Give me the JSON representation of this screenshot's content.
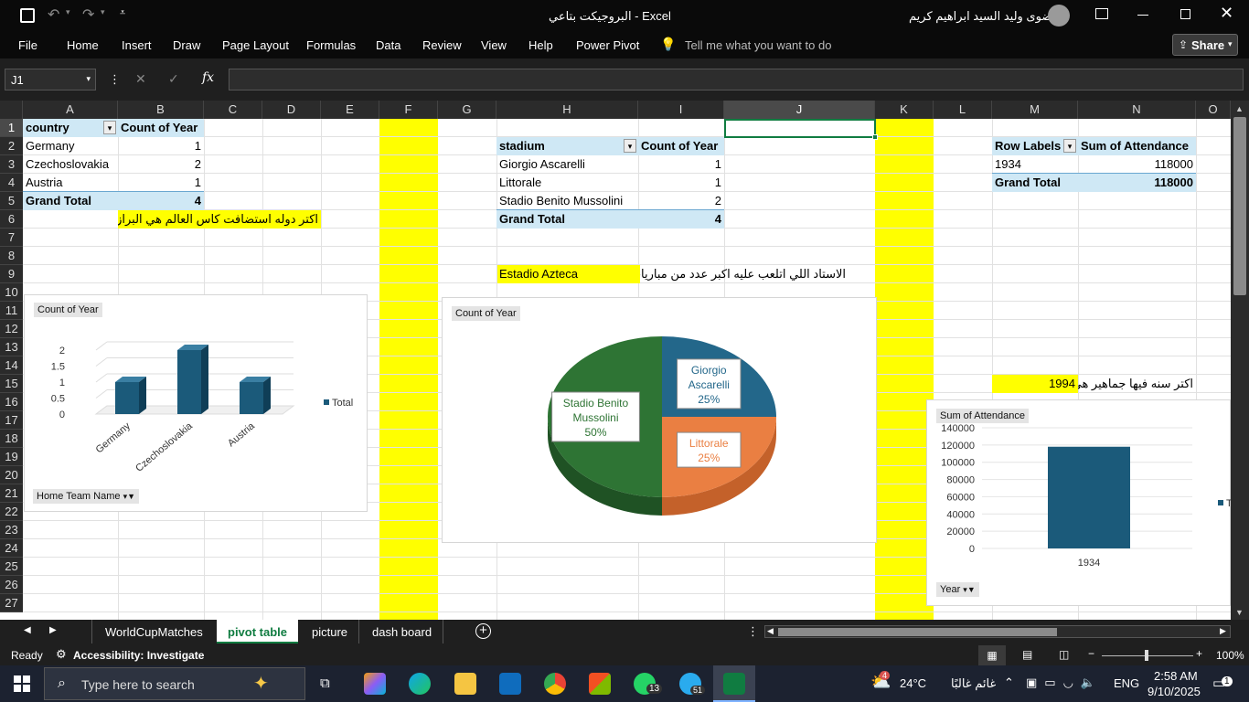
{
  "title": {
    "doc_name": "البروجيكت بتاعي",
    "app_sep": " - ",
    "app": "Excel",
    "user": "رضوى وليد السيد ابراهيم كريم"
  },
  "menu": [
    "File",
    "Home",
    "Insert",
    "Draw",
    "Page Layout",
    "Formulas",
    "Data",
    "Review",
    "View",
    "Help",
    "Power Pivot"
  ],
  "tell_me": "Tell me what you want to do",
  "share": "Share",
  "namebox": "J1",
  "columns": [
    "A",
    "B",
    "C",
    "D",
    "E",
    "F",
    "G",
    "H",
    "I",
    "J",
    "K",
    "L",
    "M",
    "N",
    "O"
  ],
  "rows": [
    "1",
    "2",
    "3",
    "4",
    "5",
    "6",
    "7",
    "8",
    "9",
    "10",
    "11",
    "12",
    "13",
    "14",
    "15",
    "16",
    "17",
    "18",
    "19",
    "20",
    "21",
    "22",
    "23",
    "24",
    "25",
    "26",
    "27"
  ],
  "pivot1": {
    "h1": "country",
    "h2": "Count of Year",
    "rows": [
      [
        "Germany",
        "1"
      ],
      [
        "Czechoslovakia",
        "2"
      ],
      [
        "Austria",
        "1"
      ]
    ],
    "total_label": "Grand Total",
    "total": "4"
  },
  "note1": "اكتر دوله استضافت كاس العالم هي البرازيل",
  "pivot2": {
    "h1": "stadium",
    "h2": "Count of Year",
    "rows": [
      [
        "Giorgio Ascarelli",
        "1"
      ],
      [
        "Littorale",
        "1"
      ],
      [
        "Stadio Benito Mussolini",
        "2"
      ]
    ],
    "total_label": "Grand Total",
    "total": "4"
  },
  "note2_highlight": "Estadio Azteca",
  "note2_rest": "الاستاد اللي اتلعب عليه اكبر عدد من مباريات كاس العالم هو",
  "pivot3": {
    "h1": "Row Labels",
    "h2": "Sum of Attendance",
    "row": [
      "1934",
      "118000"
    ],
    "total_label": "Grand Total",
    "total": "118000"
  },
  "note3_text": "اكتر سنه فيها جماهير هي",
  "note3_year": "1994",
  "chart_data": [
    {
      "type": "bar",
      "title": "Count of Year",
      "categories": [
        "Germany",
        "Czechoslovakia",
        "Austria"
      ],
      "series": [
        {
          "name": "Total",
          "values": [
            1,
            2,
            1
          ]
        }
      ],
      "ylim": [
        0,
        2
      ],
      "yticks": [
        "0",
        "0.5",
        "1",
        "1.5",
        "2"
      ],
      "filter_label": "Home Team Name",
      "legend": "right"
    },
    {
      "type": "pie",
      "title": "Count of Year",
      "categories": [
        "Giorgio Ascarelli",
        "Littorale",
        "Stadio Benito Mussolini"
      ],
      "values": [
        1,
        1,
        2
      ],
      "percent_labels": [
        "25%",
        "25%",
        "50%"
      ],
      "colors": [
        "#23678a",
        "#ea7f42",
        "#2e7434"
      ]
    },
    {
      "type": "bar",
      "title": "Sum of Attendance",
      "categories": [
        "1934"
      ],
      "series": [
        {
          "name": "Total",
          "values": [
            118000
          ]
        }
      ],
      "ylim": [
        0,
        140000
      ],
      "yticks": [
        "0",
        "20000",
        "40000",
        "60000",
        "80000",
        "100000",
        "120000",
        "140000"
      ],
      "filter_label": "Year",
      "legend": "right"
    }
  ],
  "tabs": [
    "WorldCupMatches",
    "pivot table",
    "picture",
    "dash board"
  ],
  "active_tab": "pivot table",
  "status": {
    "ready": "Ready",
    "accessibility": "Accessibility: Investigate",
    "zoom": "100%"
  },
  "taskbar": {
    "search": "Type here to search",
    "weather_temp": "24°C",
    "weather_text": "غائم غالبًا",
    "lang": "ENG",
    "time": "2:58 AM",
    "date": "9/10/2025",
    "badge_whatsapp": "13",
    "badge_telegram": "51",
    "badge_weather": "4",
    "badge_notify": "1"
  },
  "colors": {
    "yellow": "#ffff00",
    "pivot_header": "#cfe8f5",
    "bar": "#1b5a7a"
  }
}
